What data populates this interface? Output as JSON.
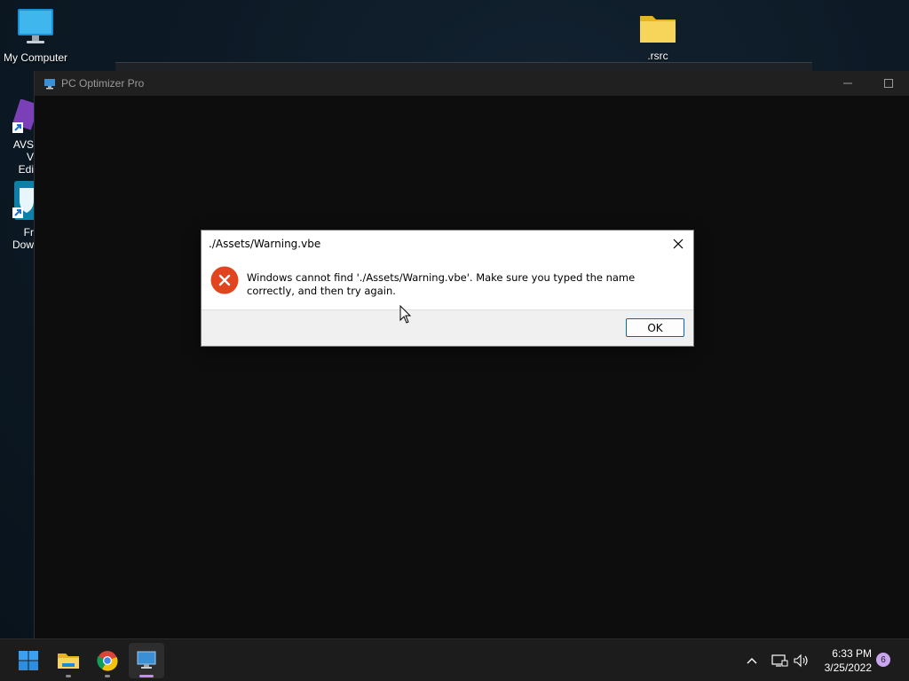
{
  "desktop": {
    "icons": [
      {
        "label": "My Computer"
      },
      {
        "label": ".rsrc"
      }
    ],
    "clipped_icons": [
      {
        "line1": "AVS V",
        "line2": "Edi"
      },
      {
        "line1": "Fr",
        "line2": "Dow"
      }
    ]
  },
  "app_window": {
    "title": "PC Optimizer Pro",
    "minimize_glyph": "—",
    "maximize_glyph": "☐"
  },
  "dialog": {
    "title": "./Assets/Warning.vbe",
    "close_glyph": "✕",
    "message": "Windows cannot find './Assets/Warning.vbe'. Make sure you typed the name correctly, and then try again.",
    "ok_label": "OK"
  },
  "taskbar": {
    "apps": [
      "start-icon",
      "file-explorer-icon",
      "chrome-icon",
      "pc-optimizer-icon"
    ],
    "tray": {
      "chevron_glyph": "^",
      "time": "6:33 PM",
      "date": "3/25/2022",
      "notification_count": "6"
    }
  },
  "colors": {
    "accent": "#0067c0",
    "error": "#e0451f",
    "taskbar": "#1c1c1c",
    "active_indicator": "#c28ff2"
  }
}
